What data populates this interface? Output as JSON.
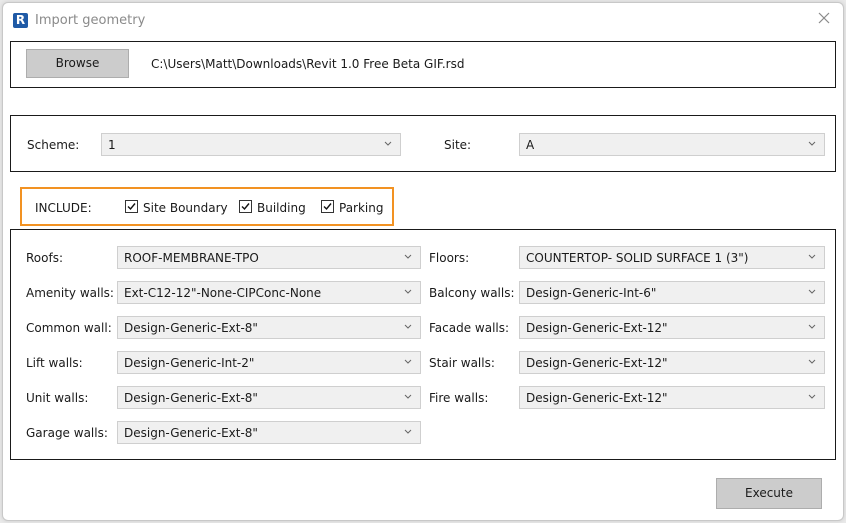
{
  "window": {
    "title": "Import geometry"
  },
  "file": {
    "browse_label": "Browse",
    "path": "C:\\Users\\Matt\\Downloads\\Revit 1.0 Free Beta GIF.rsd"
  },
  "scheme": {
    "label": "Scheme:",
    "value": "1"
  },
  "site": {
    "label": "Site:",
    "value": "A"
  },
  "include": {
    "label": "INCLUDE:",
    "options": [
      {
        "label": "Site Boundary",
        "checked": true
      },
      {
        "label": "Building",
        "checked": true
      },
      {
        "label": "Parking",
        "checked": true
      }
    ]
  },
  "left_fields": [
    {
      "label": "Roofs:",
      "value": "ROOF-MEMBRANE-TPO"
    },
    {
      "label": "Amenity walls:",
      "value": "Ext-C12-12\"-None-CIPConc-None"
    },
    {
      "label": "Common wall:",
      "value": "Design-Generic-Ext-8\""
    },
    {
      "label": "Lift walls:",
      "value": "Design-Generic-Int-2\""
    },
    {
      "label": "Unit walls:",
      "value": "Design-Generic-Ext-8\""
    },
    {
      "label": "Garage walls:",
      "value": "Design-Generic-Ext-8\""
    }
  ],
  "right_fields": [
    {
      "label": "Floors:",
      "value": "COUNTERTOP- SOLID SURFACE 1 (3\")"
    },
    {
      "label": "Balcony walls:",
      "value": "Design-Generic-Int-6\""
    },
    {
      "label": "Facade walls:",
      "value": "Design-Generic-Ext-12\""
    },
    {
      "label": "Stair walls:",
      "value": "Design-Generic-Ext-12\""
    },
    {
      "label": "Fire walls:",
      "value": "Design-Generic-Ext-12\""
    }
  ],
  "execute_label": "Execute",
  "icons": {
    "app": "revit-r-icon",
    "close": "close-icon",
    "dropdown": "chevron-down-icon",
    "check": "checkmark-icon"
  },
  "colors": {
    "include_highlight": "#f29222",
    "button_bg": "#cccccc",
    "app_icon": "#1f5aa6"
  }
}
